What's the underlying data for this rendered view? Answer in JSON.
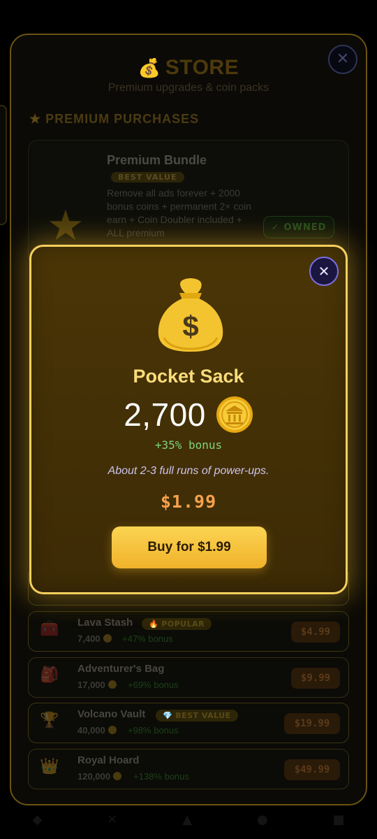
{
  "store": {
    "title": "STORE",
    "subtitle": "Premium upgrades & coin packs",
    "close_icon": "close-icon",
    "section_title": "PREMIUM PURCHASES",
    "bundle": {
      "name": "Premium Bundle",
      "badge": "BEST VALUE",
      "description": "Remove all ads forever + 2000 bonus coins + permanent 2× coin earn + Coin Doubler included + ALL premium",
      "owned_label": "OWNED",
      "icon": "star-icon"
    },
    "packs": [
      {
        "name": "Lava Stash",
        "tag": "POPULAR",
        "amount": "7,400",
        "bonus": "+47% bonus",
        "price": "$4.99",
        "icon": "chest-icon"
      },
      {
        "name": "Adventurer's Bag",
        "tag": "",
        "amount": "17,000",
        "bonus": "+69% bonus",
        "price": "$9.99",
        "icon": "backpack-icon"
      },
      {
        "name": "Volcano Vault",
        "tag": "BEST VALUE",
        "amount": "40,000",
        "bonus": "+98% bonus",
        "price": "$19.99",
        "icon": "trophy-icon"
      },
      {
        "name": "Royal Hoard",
        "tag": "",
        "amount": "120,000",
        "bonus": "+138% bonus",
        "price": "$49.99",
        "icon": "crown-icon"
      }
    ]
  },
  "modal": {
    "title": "Pocket Sack",
    "amount": "2,700",
    "bonus": "+35% bonus",
    "description": "About 2-3 full runs of power-ups.",
    "price": "$1.99",
    "buy_label": "Buy for $1.99",
    "icon": "money-bag-icon",
    "coin_icon": "coin-icon"
  },
  "colors": {
    "accent_gold": "#f3cf5e",
    "bonus_green": "#7fd47a",
    "price_orange": "#f6a24c",
    "close_purple": "#7a6ee0"
  }
}
